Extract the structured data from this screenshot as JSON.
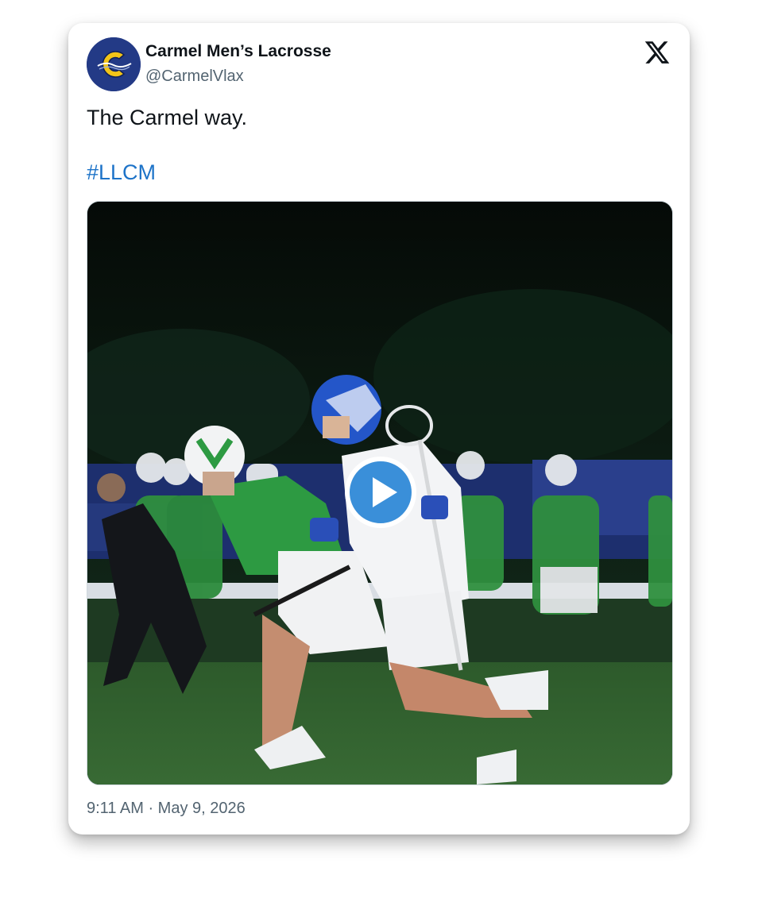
{
  "account": {
    "display_name": "Carmel Men’s Lacrosse",
    "handle": "@CarmelVlax",
    "avatar_icon": "carmel-c-logo",
    "avatar_colors": {
      "background": "#233a86",
      "letter": "#f2c418"
    }
  },
  "brand": {
    "icon": "x-logo-icon"
  },
  "tweet": {
    "text": "The Carmel way.",
    "hashtag": "#LLCM",
    "hashtag_color": "#1d73c8"
  },
  "media": {
    "type": "video",
    "play_icon": "play-icon",
    "play_color": "#3a8fd9"
  },
  "footer": {
    "timestamp": "9:11 AM · May 9, 2026"
  }
}
